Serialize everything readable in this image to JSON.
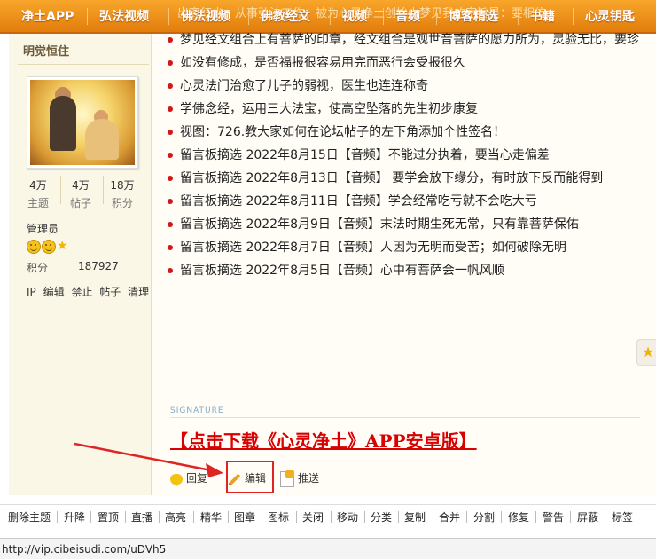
{
  "nav": {
    "marquee": "出离红尘，从事弘法工作；被为心灵净土创始人梦见我的宗旨是：要相信",
    "items": [
      "净土APP",
      "弘法视频",
      "佛法视频",
      "佛教经文",
      "视频",
      "音频",
      "博客精选",
      "书籍",
      "心灵钥匙"
    ]
  },
  "user": {
    "name": "明觉恒住",
    "stats": [
      {
        "num": "4万",
        "label": "主题"
      },
      {
        "num": "4万",
        "label": "帖子"
      },
      {
        "num": "18万",
        "label": "积分"
      }
    ],
    "group": "管理员",
    "points_label": "积分",
    "points_value": "187927",
    "admin_links": [
      "IP",
      "编辑",
      "禁止",
      "帖子",
      "清理"
    ]
  },
  "posts": [
    "梦见经文组合上有菩萨的印章，经文组合是观世音菩萨的愿力所为，灵验无比，要珍",
    "如没有修成，是否福报很容易用完而恶行会受报很久",
    "心灵法门治愈了儿子的弱视，医生也连连称奇",
    "学佛念经，运用三大法宝，使高空坠落的先生初步康复",
    "视图：726.教大家如何在论坛帖子的左下角添加个性签名！",
    "留言板摘选 2022年8月15日【音频】不能过分执着，要当心走偏差",
    "留言板摘选 2022年8月13日【音频】 要学会放下缘分，有时放下反而能得到",
    "留言板摘选 2022年8月11日【音频】学会经常吃亏就不会吃大亏",
    "留言板摘选 2022年8月9日【音频】末法时期生死无常，只有靠菩萨保佑",
    "留言板摘选 2022年8月7日【音频】人因为无明而受苦；如何破除无明",
    "留言板摘选 2022年8月5日【音频】心中有菩萨会一帆风顺"
  ],
  "signature": {
    "label": "SIGNATURE",
    "link_text": "【点击下载《心灵净土》APP安卓版】"
  },
  "actions": {
    "reply": "回复",
    "edit": "编辑",
    "push": "推送"
  },
  "toolbar": [
    "删除主题",
    "升降",
    "置顶",
    "直播",
    "高亮",
    "精华",
    "图章",
    "图标",
    "关闭",
    "移动",
    "分类",
    "复制",
    "合并",
    "分割",
    "修复",
    "警告",
    "屏蔽",
    "标签"
  ],
  "status_url": "http://vip.cibeisudi.com/uDVh5",
  "colors": {
    "nav": "#f08f1a",
    "link_red": "#d80000",
    "bullet": "#d41616",
    "highlight": "#e02424"
  }
}
